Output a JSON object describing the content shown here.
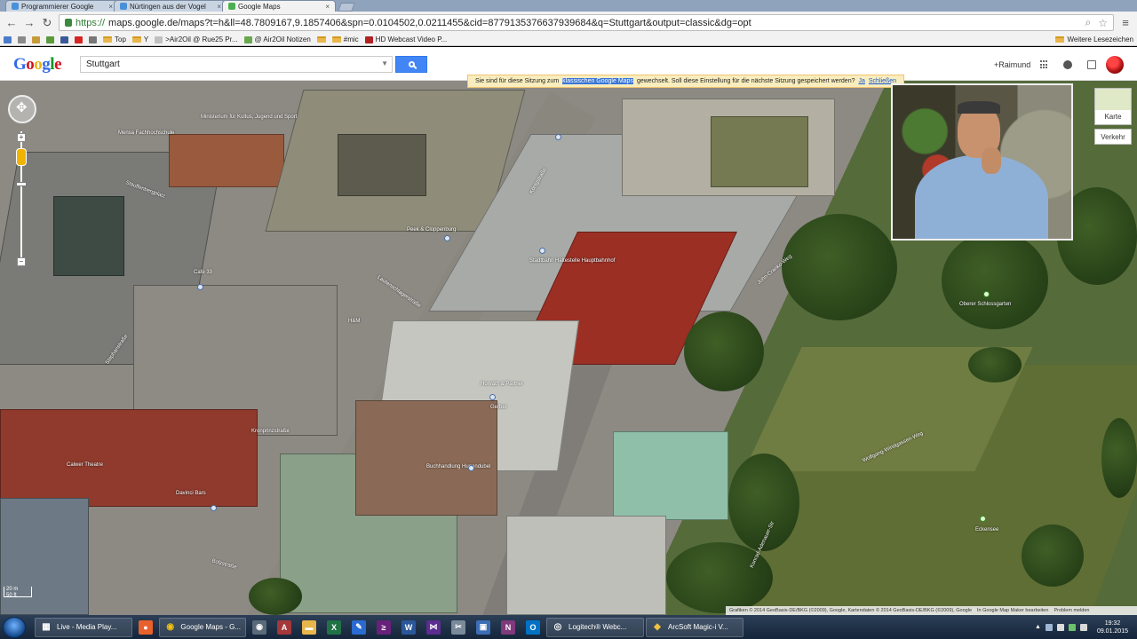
{
  "browser": {
    "tabs": [
      {
        "label": "Programmierer Google",
        "active": false,
        "favicon_color": "#4a90d9"
      },
      {
        "label": "Nürtingen aus der Vogel",
        "active": false,
        "favicon_color": "#4a90d9"
      },
      {
        "label": "Google Maps",
        "active": true,
        "favicon_color": "#4caf50"
      }
    ],
    "url": {
      "scheme": "https://",
      "rest": "maps.google.de/maps?t=h&ll=48.7809167,9.1857406&spn=0.0104502,0.0211455&cid=8779135376637939684&q=Stuttgart&output=classic&dg=opt"
    },
    "bookmarks": [
      {
        "label": "",
        "icon": "apps-icon",
        "color": "#4a7cc9"
      },
      {
        "label": "",
        "icon": "star-icon",
        "color": "#8a8a8a"
      },
      {
        "label": "",
        "icon": "page-icon",
        "color": "#c79a3a"
      },
      {
        "label": "",
        "icon": "puzzle-icon",
        "color": "#5a9a3a"
      },
      {
        "label": "",
        "icon": "facebook-icon",
        "color": "#3b5998"
      },
      {
        "label": "",
        "icon": "youtube-icon",
        "color": "#d62424"
      },
      {
        "label": "",
        "icon": "page-icon",
        "color": "#777777"
      },
      {
        "label": "Top",
        "icon": "folder-icon",
        "color": "#e8b64a"
      },
      {
        "label": "Y",
        "icon": "folder-icon",
        "color": "#e8b64a"
      },
      {
        "label": ">Air2Oil @ Rue25 Pr...",
        "icon": "page-icon",
        "color": "#c0c0c0"
      },
      {
        "label": "@ Air2Oil Notizen",
        "icon": "evernote-icon",
        "color": "#6aa84f"
      },
      {
        "label": "",
        "icon": "folder-icon",
        "color": "#e8b64a"
      },
      {
        "label": "#mic",
        "icon": "folder-icon",
        "color": "#e8b64a"
      },
      {
        "label": "HD Webcast Video P...",
        "icon": "video-icon",
        "color": "#b22222"
      }
    ],
    "other_bookmarks": "Weitere Lesezeichen"
  },
  "maps_header": {
    "logo": [
      "G",
      "o",
      "o",
      "g",
      "l",
      "e"
    ],
    "search_value": "Stuttgart",
    "user_name": "+Raimund"
  },
  "notice": {
    "prefix": "Sie sind für diese Sitzung zum",
    "highlight": "klassischen Google Maps",
    "suffix": "gewechselt. Soll diese Einstellung für die nächste Sitzung gespeichert werden?",
    "yes_link": "Ja",
    "close_link": "Schließen"
  },
  "map_type": {
    "karte": "Karte",
    "verkehr": "Verkehr"
  },
  "scale": {
    "metric": "20 m",
    "imperial": "50 ft"
  },
  "map_labels": [
    "Ministerium für Kultus, Jugend und Sport",
    "Mensa Fachhochschule",
    "Stauffenbergplatz",
    "Peek & Cloppenburg",
    "Königstraße",
    "Stadtbahn Haltestelle Hauptbahnhof",
    "Lautenschlagerstraße",
    "Cafe 33",
    "H&M",
    "Stephanstraße",
    "Kronprinzstraße",
    "Horváth & Partner",
    "Gerber",
    "Buchhandlung Hugendubel",
    "Calwer Theatre",
    "Davinci Bars",
    "Oberer Schlossgarten",
    "Wolfgang-Windgassen-Weg",
    "Eckensee",
    "Konrad-Adenauer-Str",
    "Bolzstraße",
    "John-Cranko-Weg"
  ],
  "copyright": {
    "text": "Grafiken © 2014 GeoBasis-DE/BKG (©2009), Google, Kartendaten © 2014 GeoBasis-DE/BKG (©2009), Google",
    "link": "In Google Map Maker bearbeiten",
    "report": "Problem melden"
  },
  "taskbar": {
    "tasks": [
      {
        "label": "Live - Media Play...",
        "icon": "media-player-icon"
      },
      {
        "label": "Google Maps - G...",
        "icon": "chrome-icon"
      },
      {
        "label": "Logitech® Webc...",
        "icon": "webcam-app-icon"
      },
      {
        "label": "ArcSoft Magic-i V...",
        "icon": "arcsoft-icon"
      }
    ],
    "pinned": [
      {
        "name": "media-center-icon",
        "glyph": "●",
        "color": "#e8612c"
      },
      {
        "name": "recorder-icon",
        "glyph": "◉",
        "color": "#5b6a7a"
      },
      {
        "name": "access-icon",
        "glyph": "A",
        "color": "#a4373a"
      },
      {
        "name": "explorer-folder-icon",
        "glyph": "▬",
        "color": "#e8b64a"
      },
      {
        "name": "excel-icon",
        "glyph": "X",
        "color": "#207245"
      },
      {
        "name": "sharp-icon",
        "glyph": "✎",
        "color": "#2a6bd1"
      },
      {
        "name": "visual-studio-icon",
        "glyph": "≥",
        "color": "#68217a"
      },
      {
        "name": "word-icon",
        "glyph": "W",
        "color": "#2b579a"
      },
      {
        "name": "vs-icon",
        "glyph": "⋈",
        "color": "#5c2d91"
      },
      {
        "name": "paint-icon",
        "glyph": "✂",
        "color": "#7a8a9a"
      },
      {
        "name": "remote-desktop-icon",
        "glyph": "▣",
        "color": "#3d6db5"
      },
      {
        "name": "onenote-icon",
        "glyph": "N",
        "color": "#80397b"
      },
      {
        "name": "outlook-icon",
        "glyph": "O",
        "color": "#0072c6"
      }
    ],
    "clock_time": "19:32",
    "clock_date": "09.01.2015"
  }
}
